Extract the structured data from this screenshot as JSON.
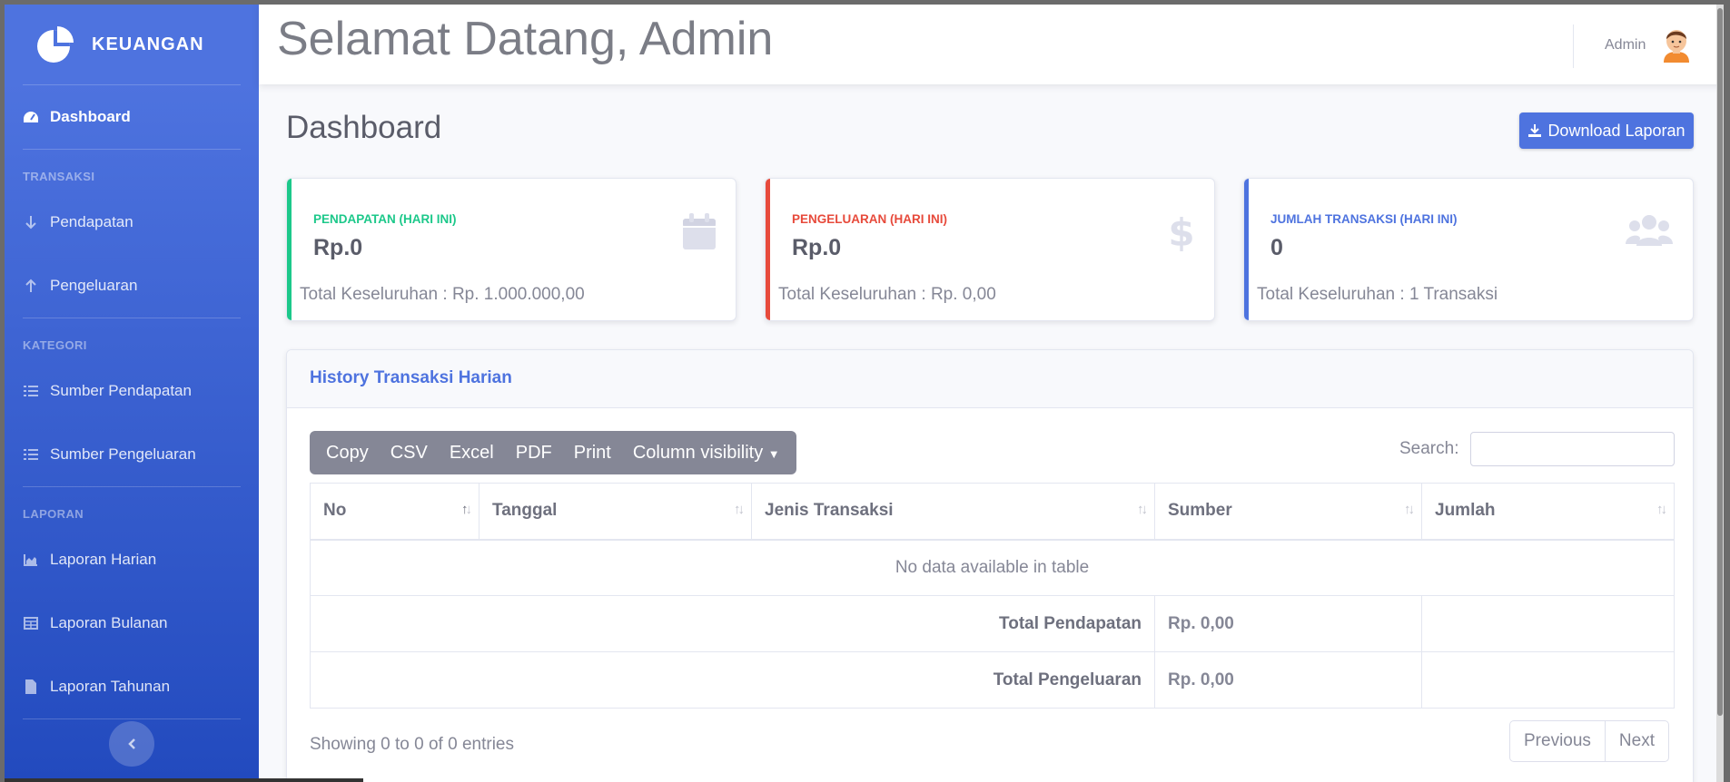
{
  "app": {
    "brand": "KEUANGAN"
  },
  "sidebar": {
    "dashboard": "Dashboard",
    "sections": {
      "transaksi": "TRANSAKSI",
      "kategori": "KATEGORI",
      "laporan": "LAPORAN"
    },
    "items": {
      "pendapatan": "Pendapatan",
      "pengeluaran": "Pengeluaran",
      "sumber_pendapatan": "Sumber Pendapatan",
      "sumber_pengeluaran": "Sumber Pengeluaran",
      "laporan_harian": "Laporan Harian",
      "laporan_bulanan": "Laporan Bulanan",
      "laporan_tahunan": "Laporan Tahunan"
    }
  },
  "topbar": {
    "welcome": "Selamat Datang, Admin",
    "user": "Admin"
  },
  "page": {
    "title": "Dashboard",
    "download": "Download Laporan"
  },
  "cards": [
    {
      "label": "PENDAPATAN (HARI INI)",
      "value": "Rp.0",
      "footer": "Total Keseluruhan : Rp. 1.000.000,00",
      "color": "#1cc88a",
      "icon": "calendar-icon"
    },
    {
      "label": "PENGELUARAN (HARI INI)",
      "value": "Rp.0",
      "footer": "Total Keseluruhan : Rp. 0,00",
      "color": "#e74a3b",
      "icon": "dollar-icon"
    },
    {
      "label": "JUMLAH TRANSAKSI (HARI INI)",
      "value": "0",
      "footer": "Total Keseluruhan : 1 Transaksi",
      "color": "#4e73df",
      "icon": "users-icon"
    }
  ],
  "history": {
    "title": "History Transaksi Harian",
    "buttons": [
      "Copy",
      "CSV",
      "Excel",
      "PDF",
      "Print",
      "Column visibility"
    ],
    "search_label": "Search:",
    "search_value": "",
    "columns": [
      "No",
      "Tanggal",
      "Jenis Transaksi",
      "Sumber",
      "Jumlah"
    ],
    "empty": "No data available in table",
    "totals": [
      {
        "label": "Total Pendapatan",
        "value": "Rp. 0,00"
      },
      {
        "label": "Total Pengeluaran",
        "value": "Rp. 0,00"
      }
    ],
    "info": "Showing 0 to 0 of 0 entries",
    "prev": "Previous",
    "next": "Next"
  }
}
